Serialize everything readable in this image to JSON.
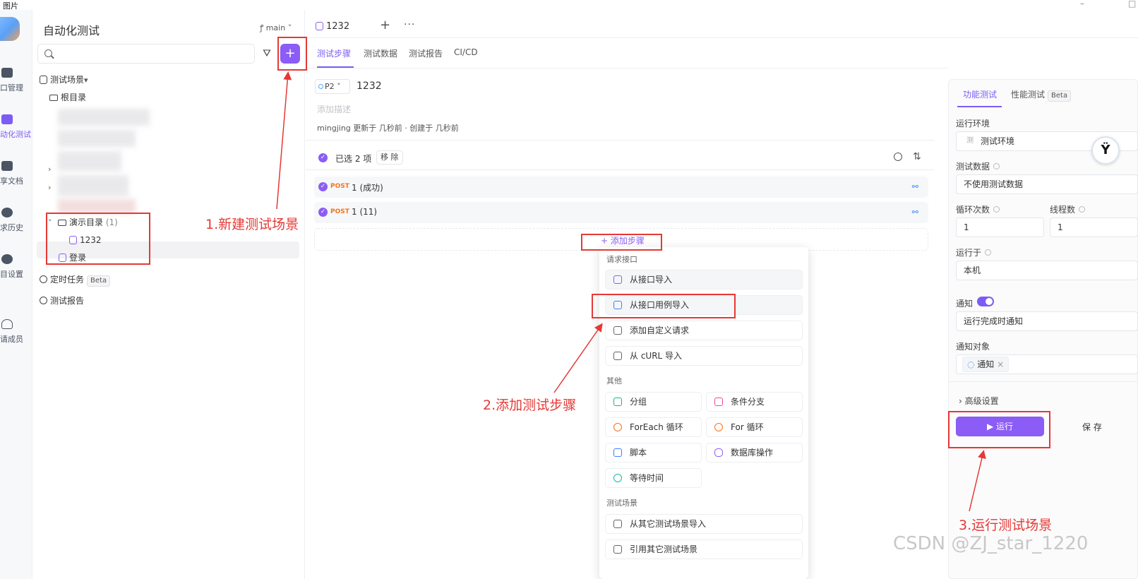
{
  "window": {
    "title": "图片"
  },
  "rail": {
    "items": [
      {
        "label": "口管理"
      },
      {
        "label": "动化测试"
      },
      {
        "label": "享文档"
      },
      {
        "label": "求历史"
      },
      {
        "label": "目设置"
      },
      {
        "label": "请成员"
      }
    ]
  },
  "sidebar": {
    "title": "自动化测试",
    "branch": "main",
    "add_label": "+",
    "tree": {
      "scenes_label": "测试场景",
      "root_label": "根目录",
      "demo_folder": "演示目录",
      "demo_count": "(1)",
      "item_1232": "1232",
      "item_login": "登录",
      "scheduled": "定时任务",
      "scheduled_badge": "Beta",
      "reports": "测试报告"
    }
  },
  "tabbar": {
    "active_tab": "1232"
  },
  "subtabs": [
    "测试步骤",
    "测试数据",
    "测试报告",
    "CI/CD"
  ],
  "scenario": {
    "priority": "P2",
    "name": "1232",
    "desc_placeholder": "添加描述",
    "meta": "mingjing 更新于 几秒前 · 创建于 几秒前"
  },
  "selection": {
    "text": "已选 2 项",
    "remove": "移 除"
  },
  "steps": [
    {
      "method": "POST",
      "name": "1 (成功)"
    },
    {
      "method": "POST",
      "name": "1 (11)"
    }
  ],
  "add_step": "+ 添加步骤",
  "menu": {
    "sec_request": "请求接口",
    "from_api": "从接口导入",
    "from_case": "从接口用例导入",
    "custom": "添加自定义请求",
    "curl": "从 cURL 导入",
    "sec_other": "其他",
    "group": "分组",
    "branch": "条件分支",
    "foreach": "ForEach 循环",
    "for": "For 循环",
    "script": "脚本",
    "db": "数据库操作",
    "wait": "等待时间",
    "sec_scene": "测试场景",
    "import_scene": "从其它测试场景导入",
    "ref_scene": "引用其它测试场景"
  },
  "right_panel": {
    "tab_func": "功能测试",
    "tab_perf": "性能测试",
    "tab_perf_badge": "Beta",
    "env_label": "运行环境",
    "env_value": "测试环境",
    "data_label": "测试数据",
    "data_value": "不使用测试数据",
    "loops_label": "循环次数",
    "loops_value": "1",
    "threads_label": "线程数",
    "threads_value": "1",
    "run_on_label": "运行于",
    "run_on_value": "本机",
    "notify_label": "通知",
    "notify_value": "运行完成时通知",
    "notify_target_label": "通知对象",
    "notify_target_value": "通知",
    "advanced": "高级设置",
    "run_button": "▶ 运行",
    "save_button": "保 存"
  },
  "annotations": {
    "step1": "1.新建测试场景",
    "step2": "2.添加测试步骤",
    "step3": "3.运行测试场景"
  },
  "watermark": "CSDN @ZJ_star_1220",
  "colors": {
    "accent": "#8b5cf6",
    "annotation": "#e53935",
    "post": "#f97316"
  }
}
